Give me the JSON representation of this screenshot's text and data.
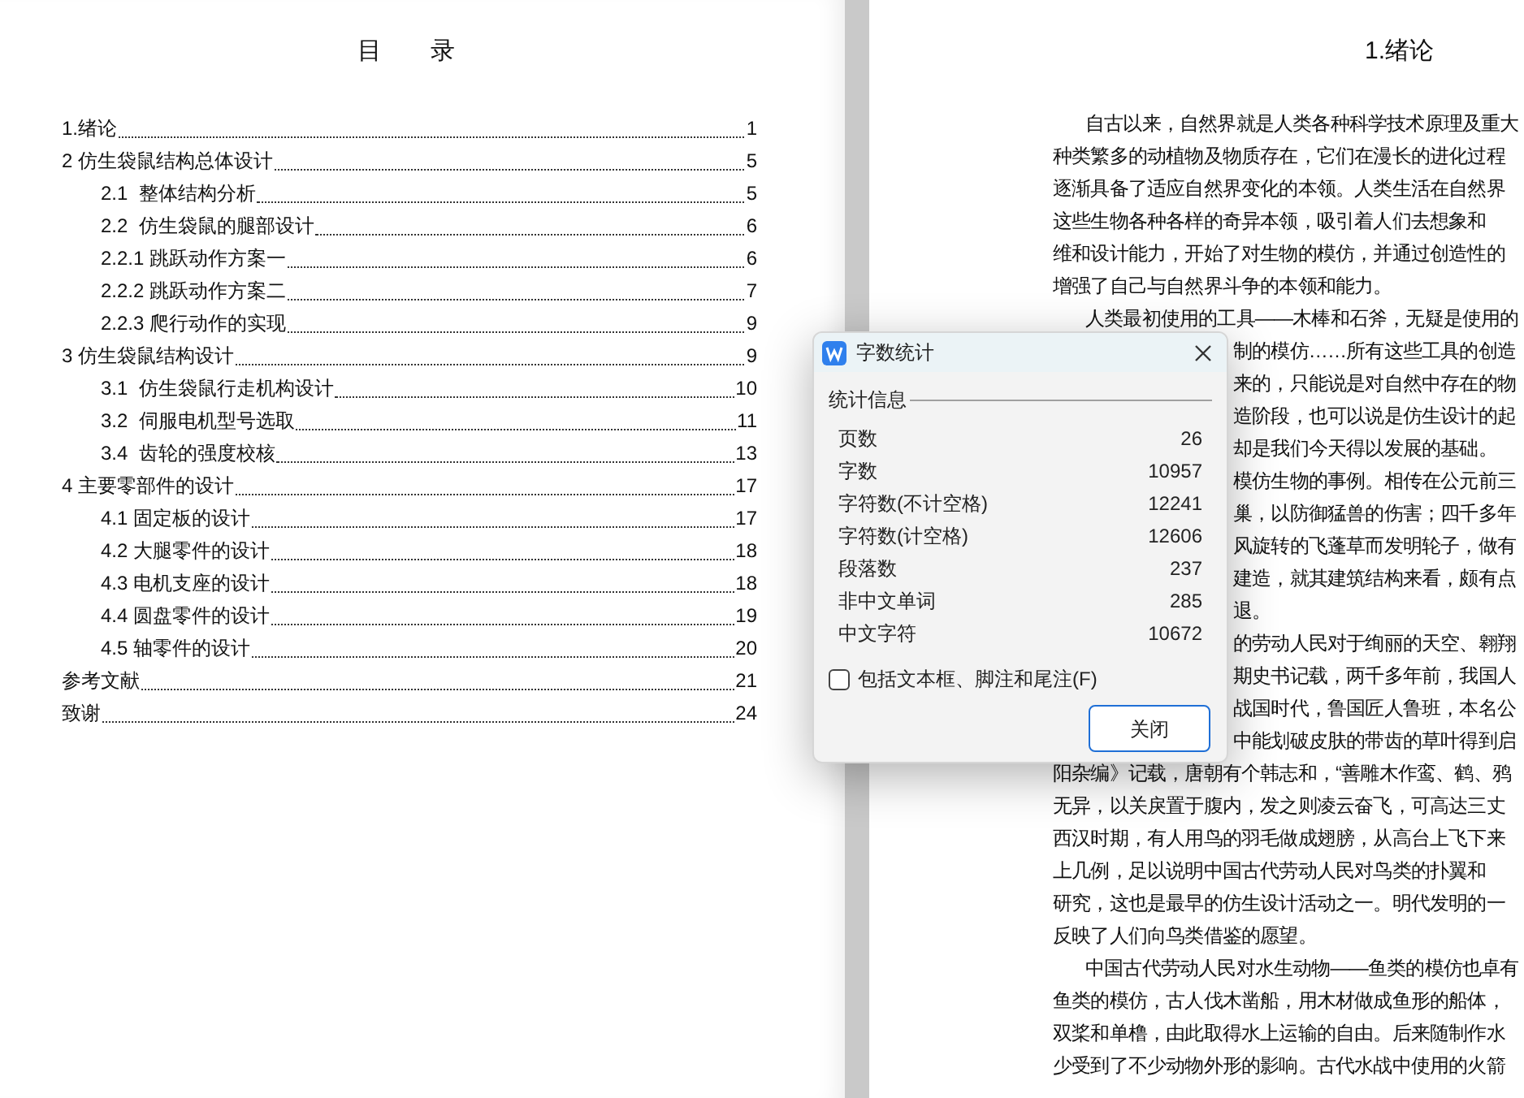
{
  "toc": {
    "title": "目　　录",
    "entries": [
      {
        "label": "1.绪论",
        "page": "1"
      },
      {
        "label": "2 仿生袋鼠结构总体设计",
        "page": "5",
        "children": [
          {
            "label": "2.1  整体结构分析",
            "page": "5"
          },
          {
            "label": "2.2  仿生袋鼠的腿部设计",
            "page": "6",
            "children": [
              {
                "label": "2.2.1 跳跃动作方案一",
                "page": "6"
              },
              {
                "label": "2.2.2 跳跃动作方案二",
                "page": "7"
              },
              {
                "label": "2.2.3 爬行动作的实现",
                "page": "9"
              }
            ]
          }
        ]
      },
      {
        "label": "3 仿生袋鼠结构设计",
        "page": "9",
        "children": [
          {
            "label": "3.1  仿生袋鼠行走机构设计",
            "page": "10"
          },
          {
            "label": "3.2  伺服电机型号选取",
            "page": "11"
          },
          {
            "label": "3.4  齿轮的强度校核",
            "page": "13"
          }
        ]
      },
      {
        "label": "4 主要零部件的设计",
        "page": "17",
        "children": [
          {
            "label": "4.1 固定板的设计",
            "page": "17"
          },
          {
            "label": "4.2 大腿零件的设计",
            "page": "18"
          },
          {
            "label": "4.3 电机支座的设计",
            "page": "18"
          },
          {
            "label": "4.4 圆盘零件的设计",
            "page": "19"
          },
          {
            "label": "4.5 轴零件的设计",
            "page": "20"
          }
        ]
      },
      {
        "label": "参考文献",
        "page": "21"
      },
      {
        "label": "致谢",
        "page": "24"
      }
    ]
  },
  "chapter": {
    "title": "1.绪论",
    "lines": [
      {
        "kind": "indent",
        "text": "自古以来，自然界就是人类各种科学技术原理及重大"
      },
      {
        "kind": "plain",
        "text": "种类繁多的动植物及物质存在，它们在漫长的进化过程"
      },
      {
        "kind": "plain",
        "text": "逐渐具备了适应自然界变化的本领。人类生活在自然界"
      },
      {
        "kind": "plain",
        "text": "这些生物各种各样的奇异本领，吸引着人们去想象和"
      },
      {
        "kind": "plain",
        "text": "维和设计能力，开始了对生物的模仿，并通过创造性的"
      },
      {
        "kind": "plain",
        "text": "增强了自己与自然界斗争的本领和能力。"
      },
      {
        "kind": "indent",
        "text": "人类最初使用的工具——木棒和石斧，无疑是使用的"
      },
      {
        "kind": "covered",
        "text": "制的模仿……所有这些工具的创造"
      },
      {
        "kind": "covered",
        "text": "来的，只能说是对自然中存在的物"
      },
      {
        "kind": "covered",
        "text": "造阶段，也可以说是仿生设计的起"
      },
      {
        "kind": "covered",
        "text": "却是我们今天得以发展的基础。"
      },
      {
        "kind": "covered",
        "text": "模仿生物的事例。相传在公元前三"
      },
      {
        "kind": "covered",
        "text": "巢，以防御猛兽的伤害；四千多年"
      },
      {
        "kind": "covered",
        "text": "风旋转的飞蓬草而发明轮子，做有"
      },
      {
        "kind": "covered",
        "text": "建造，就其建筑结构来看，颇有点"
      },
      {
        "kind": "covered",
        "text": "退。"
      },
      {
        "kind": "covered",
        "text": "的劳动人民对于绚丽的天空、翱翔"
      },
      {
        "kind": "covered",
        "text": "期史书记载，两千多年前，我国人"
      },
      {
        "kind": "covered",
        "text": "战国时代，鲁国匠人鲁班，本名公"
      },
      {
        "kind": "covered",
        "text": "中能划破皮肤的带齿的草叶得到启"
      },
      {
        "kind": "plain",
        "text": "阳杂编》记载，唐朝有个韩志和，“善雕木作鸾、鹤、鸦"
      },
      {
        "kind": "plain",
        "text": "无异，以关戾置于腹内，发之则凌云奋飞，可高达三丈"
      },
      {
        "kind": "plain",
        "text": "西汉时期，有人用鸟的羽毛做成翅膀，从高台上飞下来"
      },
      {
        "kind": "plain",
        "text": "上几例，足以说明中国古代劳动人民对鸟类的扑翼和"
      },
      {
        "kind": "plain",
        "text": "研究，这也是最早的仿生设计活动之一。明代发明的一"
      },
      {
        "kind": "plain",
        "text": "反映了人们向鸟类借鉴的愿望。"
      },
      {
        "kind": "indent",
        "text": "中国古代劳动人民对水生动物——鱼类的模仿也卓有"
      },
      {
        "kind": "plain",
        "text": "鱼类的模仿，古人伐木凿船，用木材做成鱼形的船体，"
      },
      {
        "kind": "plain",
        "text": "双桨和单橹，由此取得水上运输的自由。后来随制作水"
      },
      {
        "kind": "plain",
        "text": "少受到了不少动物外形的影响。古代水战中使用的火箭"
      }
    ]
  },
  "dialog": {
    "title": "字数统计",
    "group": "统计信息",
    "stats": [
      {
        "label": "页数",
        "value": "26"
      },
      {
        "label": "字数",
        "value": "10957"
      },
      {
        "label": "字符数(不计空格)",
        "value": "12241"
      },
      {
        "label": "字符数(计空格)",
        "value": "12606"
      },
      {
        "label": "段落数",
        "value": "237"
      },
      {
        "label": "非中文单词",
        "value": "285"
      },
      {
        "label": "中文字符",
        "value": "10672"
      }
    ],
    "include_option": {
      "label": "包括文本框、脚注和尾注(F)",
      "checked": false
    },
    "close_button": "关闭"
  }
}
